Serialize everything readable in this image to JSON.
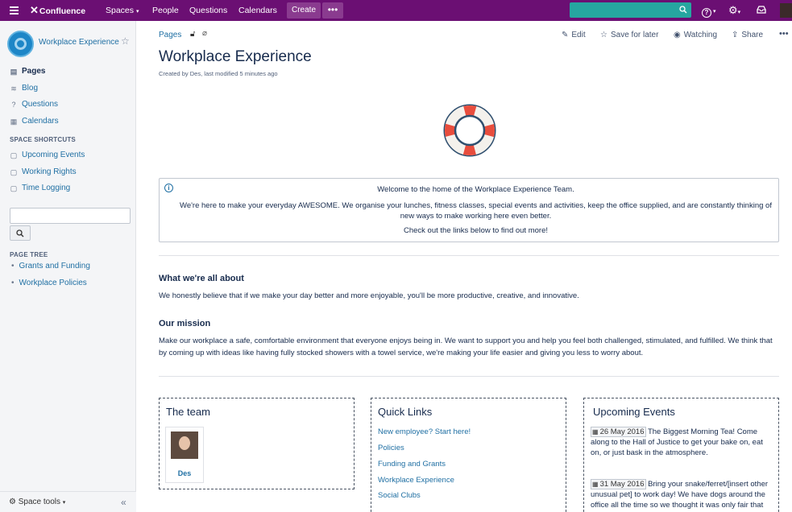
{
  "topbar": {
    "logo": "Confluence",
    "nav": [
      "Spaces",
      "People",
      "Questions",
      "Calendars"
    ],
    "create": "Create",
    "more": "•••",
    "help": "?",
    "colors": {
      "bar": "#6b0f73",
      "search": "#26a6a0",
      "create": "#8a3b8f"
    }
  },
  "sidebar": {
    "space_name": "Workplace Experience",
    "links": [
      {
        "label": "Pages",
        "icon": "pages-icon"
      },
      {
        "label": "Blog",
        "icon": "blog-icon"
      },
      {
        "label": "Questions",
        "icon": "questions-icon"
      },
      {
        "label": "Calendars",
        "icon": "calendar-icon"
      }
    ],
    "shortcuts_heading": "SPACE SHORTCUTS",
    "shortcuts": [
      "Upcoming Events",
      "Working Rights",
      "Time Logging"
    ],
    "tree_heading": "PAGE TREE",
    "tree": [
      "Grants and Funding",
      "Workplace Policies"
    ],
    "space_tools": "Space tools"
  },
  "page": {
    "breadcrumb": "Pages",
    "actions": {
      "edit": "Edit",
      "save": "Save for later",
      "watch": "Watching",
      "share": "Share"
    },
    "title": "Workplace Experience",
    "meta": "Created by Des, last modified 5 minutes ago",
    "info": {
      "line1": "Welcome to the home of the Workplace Experience Team.",
      "line2": "We're here to make your everyday AWESOME. We organise your lunches, fitness classes, special events and activities, keep the office supplied, and are constantly thinking of new ways to make working here even better.",
      "line3": "Check out the links below to find out more!"
    },
    "about_heading": "What we're all about",
    "about_text": "We honestly believe that if we make your day better and more enjoyable, you'll be more productive, creative, and innovative.",
    "mission_heading": "Our mission",
    "mission_text": "Make our workplace a safe, comfortable environment that everyone enjoys being in. We want to support you and help you feel both challenged, stimulated, and fulfilled. We think that by coming up with ideas like having fully stocked showers with a towel service, we're making your life easier and giving you less to worry about."
  },
  "panels": {
    "team": {
      "title": "The team",
      "member": "Des"
    },
    "quick_links": {
      "title": "Quick Links",
      "links": [
        "New employee? Start here!",
        "Policies",
        "Funding and Grants",
        "Workplace Experience",
        "Social Clubs"
      ]
    },
    "events": {
      "title": "Upcoming Events",
      "items": [
        {
          "date": "26 May 2016",
          "text": " The Biggest Morning Tea! Come along to the Hall of Justice to get your bake on, eat on, or just bask in the atmosphere."
        },
        {
          "date": "31 May 2016",
          "text": " Bring your snake/ferret/[insert other unusual pet] to work day! We have dogs around the office all the time so we thought it was only fair that"
        }
      ]
    }
  }
}
